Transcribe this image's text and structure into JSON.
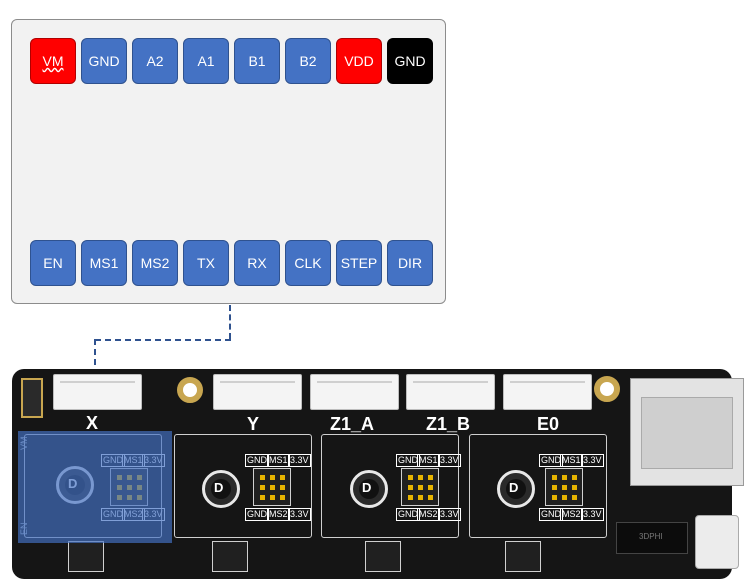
{
  "pinout": {
    "top_row": [
      {
        "label": "VM",
        "color": "#ff0000"
      },
      {
        "label": "GND",
        "color": "#4472c4"
      },
      {
        "label": "A2",
        "color": "#4472c4"
      },
      {
        "label": "A1",
        "color": "#4472c4"
      },
      {
        "label": "B1",
        "color": "#4472c4"
      },
      {
        "label": "B2",
        "color": "#4472c4"
      },
      {
        "label": "VDD",
        "color": "#ff0000"
      },
      {
        "label": "GND",
        "color": "#000000"
      }
    ],
    "bottom_row": [
      {
        "label": "EN",
        "color": "#4472c4"
      },
      {
        "label": "MS1",
        "color": "#4472c4"
      },
      {
        "label": "MS2",
        "color": "#4472c4"
      },
      {
        "label": "TX",
        "color": "#4472c4"
      },
      {
        "label": "RX",
        "color": "#4472c4"
      },
      {
        "label": "CLK",
        "color": "#4472c4"
      },
      {
        "label": "STEP",
        "color": "#4472c4"
      },
      {
        "label": "DIR",
        "color": "#4472c4"
      }
    ]
  },
  "board": {
    "axes": [
      "X",
      "Y",
      "Z1_A",
      "Z1_B",
      "E0"
    ],
    "driver_labels": {
      "gnd": "GND",
      "ms1": "MS1",
      "ms2": "MS2",
      "v33": "3.3V"
    },
    "cap_label": "D",
    "overlay_vm": "VM",
    "overlay_en": "EN",
    "chip_text": "3DPHI"
  }
}
